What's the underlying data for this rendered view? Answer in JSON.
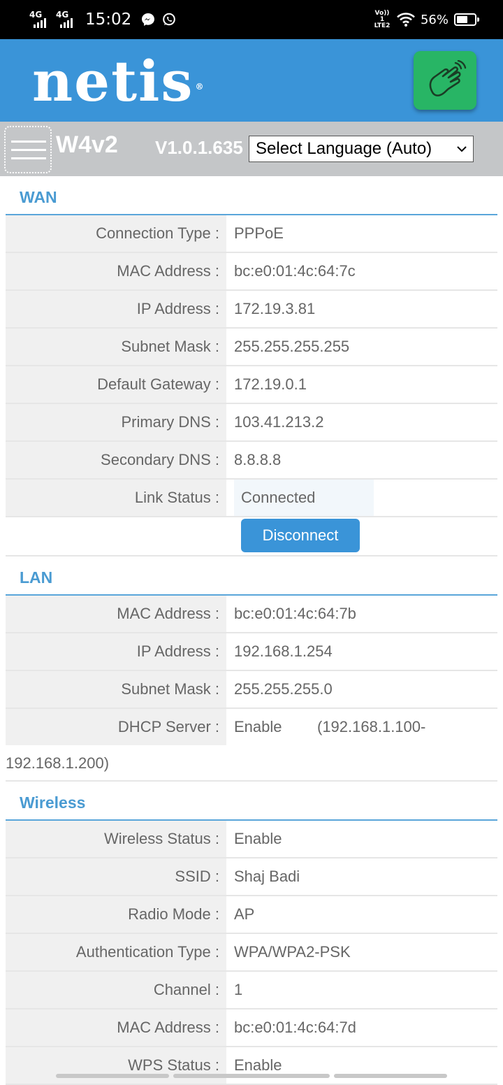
{
  "status_bar": {
    "net1": "4G",
    "net2": "4G",
    "time": "15:02",
    "volte_top": "Vo)) 1",
    "volte_bottom": "LTE2",
    "battery": "56%",
    "app_icons": [
      "messenger-icon",
      "whatsapp-icon"
    ]
  },
  "brand": {
    "logo": "netis",
    "logo_mark": "®",
    "accent": "#3a94d8",
    "hand_button_color": "#28b565"
  },
  "device": {
    "model": "W4v2",
    "version": "V1.0.1.635",
    "language_select": "Select Language (Auto)"
  },
  "wan": {
    "title": "WAN",
    "rows": [
      {
        "label": "Connection Type :",
        "value": "PPPoE"
      },
      {
        "label": "MAC Address :",
        "value": "bc:e0:01:4c:64:7c"
      },
      {
        "label": "IP Address :",
        "value": "172.19.3.81"
      },
      {
        "label": "Subnet Mask :",
        "value": "255.255.255.255"
      },
      {
        "label": "Default Gateway :",
        "value": "172.19.0.1"
      },
      {
        "label": "Primary DNS :",
        "value": "103.41.213.2"
      },
      {
        "label": "Secondary DNS :",
        "value": "8.8.8.8"
      }
    ],
    "link_status_label": "Link Status :",
    "link_status_value": "Connected",
    "disconnect_label": "Disconnect"
  },
  "lan": {
    "title": "LAN",
    "rows": [
      {
        "label": "MAC Address :",
        "value": "bc:e0:01:4c:64:7b"
      },
      {
        "label": "IP Address :",
        "value": "192.168.1.254"
      },
      {
        "label": "Subnet Mask :",
        "value": "255.255.255.0"
      }
    ],
    "dhcp_label": "DHCP Server :",
    "dhcp_state": "Enable",
    "dhcp_range_start": "(192.168.1.100-",
    "dhcp_range_end": "192.168.1.200)"
  },
  "wireless": {
    "title": "Wireless",
    "rows": [
      {
        "label": "Wireless Status :",
        "value": "Enable"
      },
      {
        "label": "SSID :",
        "value": "Shaj Badi"
      },
      {
        "label": "Radio Mode :",
        "value": "AP"
      },
      {
        "label": "Authentication Type :",
        "value": "WPA/WPA2-PSK"
      },
      {
        "label": "Channel :",
        "value": "1"
      },
      {
        "label": "MAC Address :",
        "value": "bc:e0:01:4c:64:7d"
      },
      {
        "label": "WPS Status :",
        "value": "Enable"
      }
    ]
  }
}
